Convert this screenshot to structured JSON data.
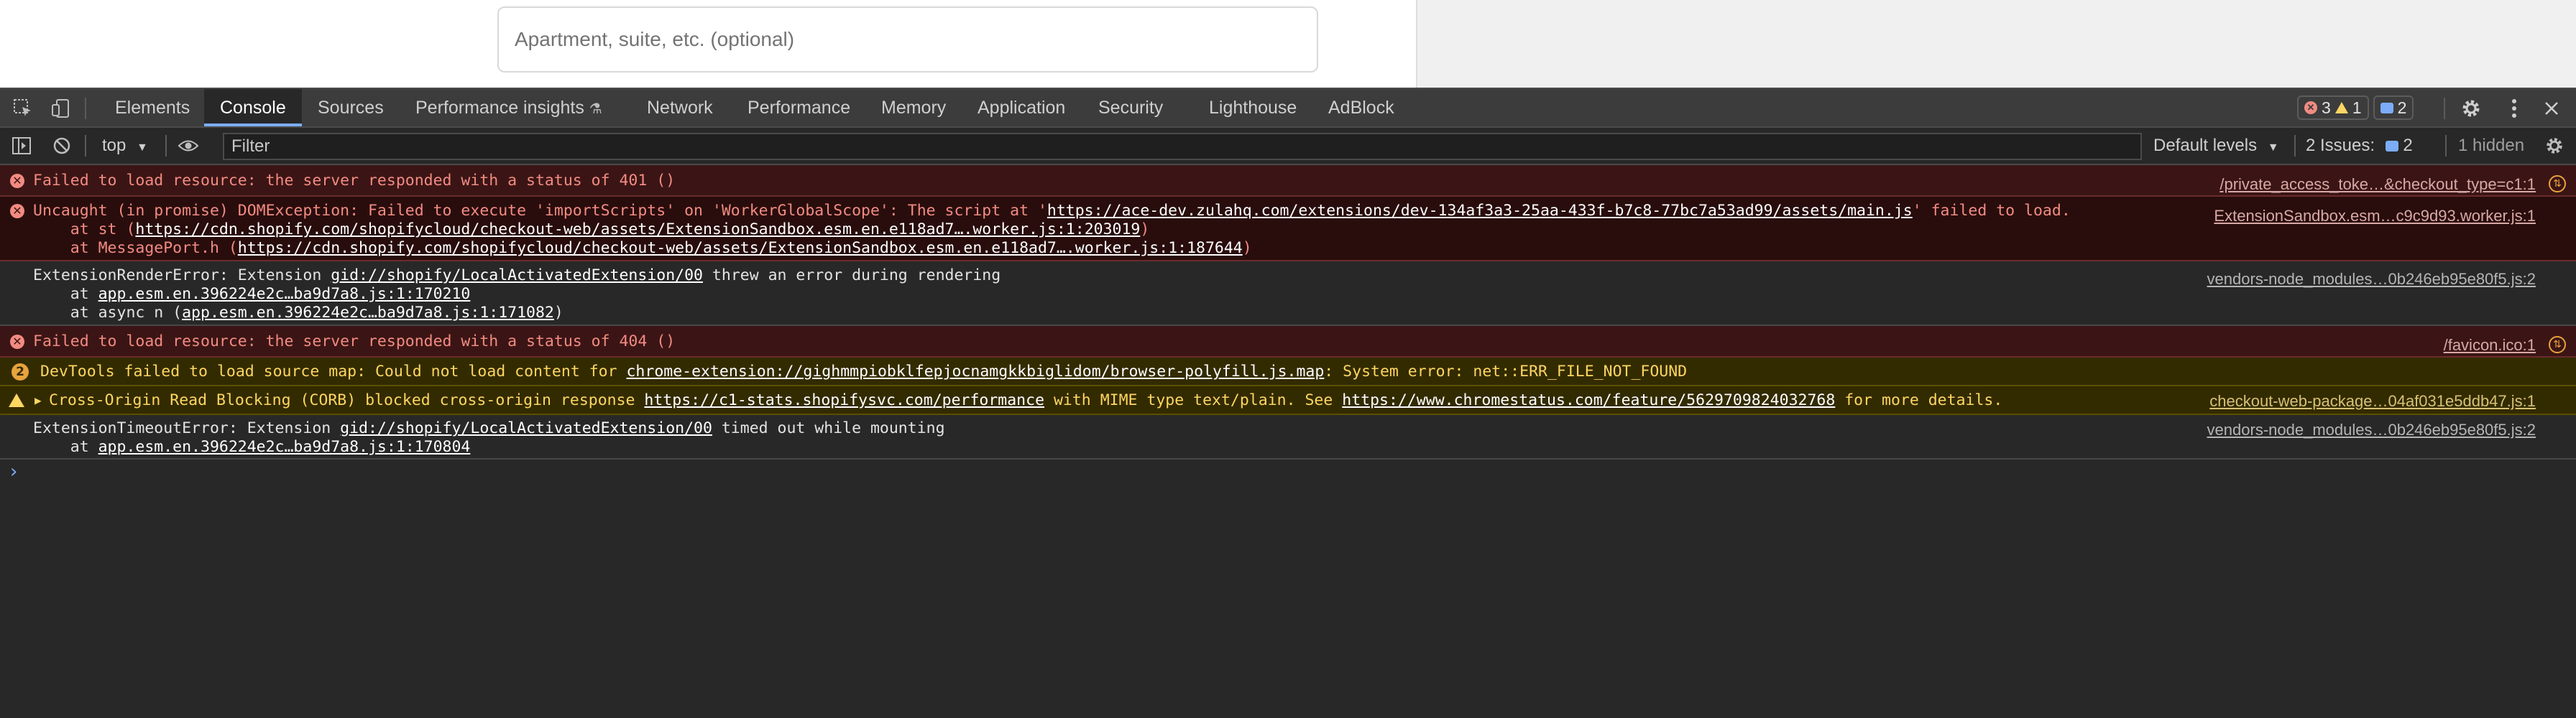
{
  "page": {
    "address_placeholder": "Apartment, suite, etc. (optional)"
  },
  "devtools": {
    "tabs": [
      {
        "label": "Elements"
      },
      {
        "label": "Console"
      },
      {
        "label": "Sources"
      },
      {
        "label": "Performance insights"
      },
      {
        "label": "Network"
      },
      {
        "label": "Performance"
      },
      {
        "label": "Memory"
      },
      {
        "label": "Application"
      },
      {
        "label": "Security"
      },
      {
        "label": "Lighthouse"
      },
      {
        "label": "AdBlock"
      }
    ],
    "active_tab": "Console",
    "counts": {
      "errors": "3",
      "warnings": "1",
      "messages": "2"
    },
    "filterbar": {
      "context": "top",
      "filter_placeholder": "Filter",
      "levels": "Default levels",
      "issues_label": "2 Issues:",
      "issues_count": "2",
      "hidden": "1 hidden"
    },
    "colors": {
      "accent": "#7cacf8",
      "error": "#f28b82",
      "warning": "#fdd663",
      "bg": "#282828"
    }
  },
  "console": {
    "m1": {
      "text": "Failed to load resource: the server responded with a status of 401 ()",
      "source": "/private_access_toke…&checkout_type=c1:1"
    },
    "m2": {
      "l1_pre": "Uncaught (in promise) DOMException: Failed to execute 'importScripts' on 'WorkerGlobalScope': The script at '",
      "l1_link": "https://ace-dev.zulahq.com/extensions/dev-134af3a3-25aa-433f-b7c8-77bc7a53ad99/assets/main.js",
      "l1_post": "' failed to load.",
      "l2_pre": "    at st (",
      "l2_link": "https://cdn.shopify.com/shopifycloud/checkout-web/assets/ExtensionSandbox.esm.en.e118ad7….worker.js:1:203019",
      "l2_post": ")",
      "l3_pre": "    at MessagePort.h (",
      "l3_link": "https://cdn.shopify.com/shopifycloud/checkout-web/assets/ExtensionSandbox.esm.en.e118ad7….worker.js:1:187644",
      "l3_post": ")",
      "source": "ExtensionSandbox.esm…c9c9d93.worker.js:1"
    },
    "m3": {
      "l1_pre": "ExtensionRenderError: Extension ",
      "l1_link": "gid://shopify/LocalActivatedExtension/00",
      "l1_post": " threw an error during rendering",
      "l2_pre": "    at ",
      "l2_link": "app.esm.en.396224e2c…ba9d7a8.js:1:170210",
      "l3_pre": "    at async n (",
      "l3_link": "app.esm.en.396224e2c…ba9d7a8.js:1:171082",
      "l3_post": ")",
      "source": "vendors-node_modules…0b246eb95e80f5.js:2"
    },
    "m4": {
      "text": "Failed to load resource: the server responded with a status of 404 ()",
      "source": "/favicon.ico:1"
    },
    "m5": {
      "badge": "2",
      "pre": "DevTools failed to load source map: Could not load content for ",
      "link": "chrome-extension://gighmmpiobklfepjocnamgkkbiglidom/browser-polyfill.js.map",
      "post": ": System error: net::ERR_FILE_NOT_FOUND"
    },
    "m6": {
      "pre": "Cross-Origin Read Blocking (CORB) blocked cross-origin response ",
      "link1": "https://c1-stats.shopifysvc.com/performance",
      "mid": " with MIME type text/plain. See ",
      "link2": "https://www.chromestatus.com/feature/5629709824032768",
      "post": " for more details.",
      "source": "checkout-web-package…04af031e5ddb47.js:1"
    },
    "m7": {
      "l1_pre": "ExtensionTimeoutError: Extension ",
      "l1_link": "gid://shopify/LocalActivatedExtension/00",
      "l1_post": " timed out while mounting",
      "l2_pre": "    at ",
      "l2_link": "app.esm.en.396224e2c…ba9d7a8.js:1:170804",
      "source": "vendors-node_modules…0b246eb95e80f5.js:2"
    }
  }
}
